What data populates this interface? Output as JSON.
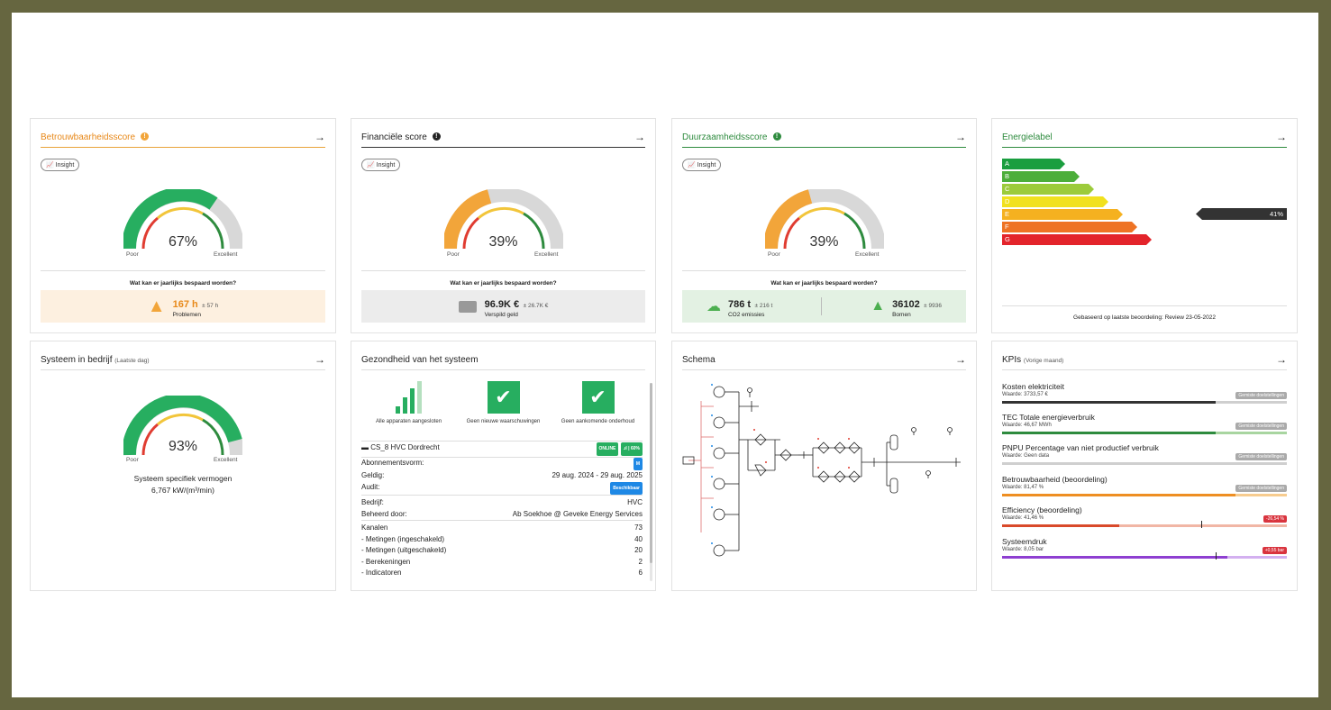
{
  "colors": {
    "green": "#27ae60",
    "orange": "#f2a53a",
    "grey": "#d8d8d8",
    "red": "#e03c31",
    "dark": "#333333"
  },
  "reliability": {
    "title": "Betrouwbaarheidsscore",
    "info": "!",
    "insight": "Insight",
    "percent": "67%",
    "gauge_value": 0.67,
    "poor": "Poor",
    "excellent": "Excellent",
    "question": "Wat kan er jaarlijks bespaard worden?",
    "value": "167 h",
    "pm": "± 57 h",
    "sub": "Problemen"
  },
  "financial": {
    "title": "Financiële score",
    "info": "!",
    "insight": "Insight",
    "percent": "39%",
    "gauge_value": 0.39,
    "poor": "Poor",
    "excellent": "Excellent",
    "question": "Wat kan er jaarlijks bespaard worden?",
    "value": "96.9K €",
    "pm": "± 26.7K €",
    "sub": "Verspild geld"
  },
  "sustainability": {
    "title": "Duurzaamheidsscore",
    "info": "!",
    "insight": "Insight",
    "percent": "39%",
    "gauge_value": 0.39,
    "poor": "Poor",
    "excellent": "Excellent",
    "question": "Wat kan er jaarlijks bespaard worden?",
    "co2_value": "786 t",
    "co2_pm": "± 216 t",
    "co2_sub": "CO2 emissies",
    "trees_value": "36102",
    "trees_pm": "± 9936",
    "trees_sub": "Bomen"
  },
  "energy": {
    "title": "Energielabel",
    "labels": [
      "A",
      "B",
      "C",
      "D",
      "E",
      "F",
      "G"
    ],
    "label_colors": [
      "#1a9e3f",
      "#4cae3a",
      "#9ccb3b",
      "#f1e11e",
      "#f5b120",
      "#ee7324",
      "#e3242b"
    ],
    "marker": "41%",
    "marker_label": "E",
    "footer": "Gebaseerd op laatste beoordeling: Review 23-05-2022"
  },
  "system": {
    "title": "Systeem in bedrijf",
    "period": "(Laatste dag)",
    "percent": "93%",
    "gauge_value": 0.93,
    "poor": "Poor",
    "excellent": "Excellent",
    "caption": "Systeem specifiek vermogen",
    "value": "6,767 kW/(m³/min)"
  },
  "health": {
    "title": "Gezondheid van het systeem",
    "checks": [
      "Alle apparaten aangesloten",
      "Geen nieuwe waarschuwingen",
      "Geen aankomende onderhoud"
    ],
    "site": "CS_8 HVC Dordrecht",
    "online": "ONLINE",
    "signal": "60%",
    "sub_label": "Abonnementsvorm:",
    "sub_badge": "M",
    "valid_label": "Geldig:",
    "valid_value": "29 aug. 2024 - 29 aug. 2025",
    "audit_label": "Audit:",
    "audit_badge": "Beschikbaar",
    "company_label": "Bedrijf:",
    "company_value": "HVC",
    "managed_label": "Beheerd door:",
    "managed_value": "Ab Soekhoe @ Geveke Energy Services",
    "channels_label": "Kanalen",
    "channels_value": "73",
    "m_on_label": "- Metingen (ingeschakeld)",
    "m_on_value": "40",
    "m_off_label": "- Metingen (uitgeschakeld)",
    "m_off_value": "20",
    "calc_label": "- Berekeningen",
    "calc_value": "2",
    "ind_label": "- Indicatoren",
    "ind_value": "6"
  },
  "schema": {
    "title": "Schema"
  },
  "kpis": {
    "title": "KPIs",
    "period": "(Vorige maand)",
    "items": [
      {
        "name": "Kosten elektriciteit",
        "value": "Waarde: 3733,57 €",
        "badge": "Gemiste doelstellingen",
        "fill": 0.75,
        "color": "#333333",
        "track": "#cfcfcf",
        "badge_color": "#aaaaaa"
      },
      {
        "name": "TEC Totale energieverbruik",
        "value": "Waarde: 46,67 MWh",
        "badge": "Gemiste doelstellingen",
        "fill": 0.75,
        "color": "#2e8b3e",
        "track": "#a8d5a0",
        "badge_color": "#aaaaaa"
      },
      {
        "name": "PNPU Percentage van niet productief verbruik",
        "value": "Waarde: Geen data",
        "badge": "Gemiste doelstellingen",
        "fill": 0,
        "color": "#cfcfcf",
        "track": "#cfcfcf",
        "badge_color": "#aaaaaa"
      },
      {
        "name": "Betrouwbaarheid (beoordeling)",
        "value": "Waarde: 81,47 %",
        "badge": "Gemiste doelstellingen",
        "fill": 0.82,
        "color": "#ee8e22",
        "track": "#f7cc8f",
        "badge_color": "#aaaaaa"
      },
      {
        "name": "Efficiency (beoordeling)",
        "value": "Waarde: 41,46 %",
        "badge": "-26,54 %",
        "fill": 0.41,
        "color": "#d94a2b",
        "track": "#f1b6a5",
        "badge_color": "#d9343e"
      },
      {
        "name": "Systeemdruk",
        "value": "Waarde: 8,05 bar",
        "badge": "+0,55 bar",
        "fill": 0.79,
        "color": "#8e3fd1",
        "track": "#d3b0f0",
        "badge_color": "#d9343e"
      }
    ]
  }
}
